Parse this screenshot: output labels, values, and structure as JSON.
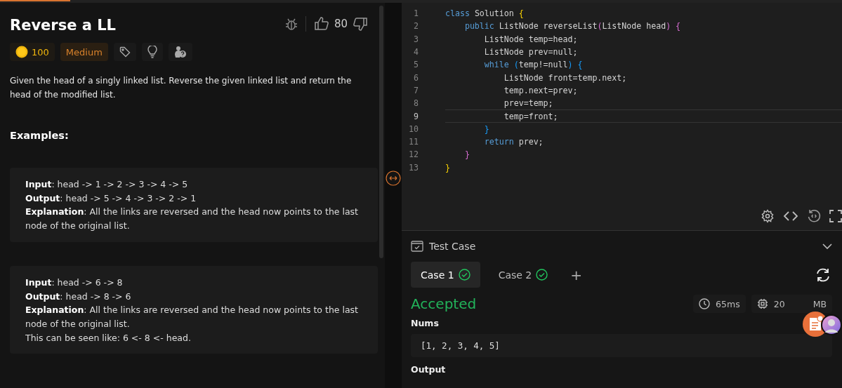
{
  "problem": {
    "title": "Reverse a LL",
    "likes": "80",
    "coins": "100",
    "difficulty": "Medium",
    "description": "Given the head of a singly linked list. Reverse the given linked list and return the head of the modified list.",
    "examples_heading": "Examples:",
    "examples": [
      {
        "lines": [
          "**Input**: head -> 1 -> 2 -> 3 -> 4 -> 5",
          "**Output**: head -> 5 -> 4 -> 3 -> 2 -> 1",
          "**Explanation**: All the links are reversed and the head now points to the last node of the original list."
        ]
      },
      {
        "lines": [
          "**Input**: head -> 6 -> 8",
          "**Output**: head -> 8 -> 6",
          "**Explanation**: All the links are reversed and the head now points to the last node of the original list.",
          "This can be seen like: 6 <- 8 <- head."
        ]
      }
    ]
  },
  "editor": {
    "lines": [
      {
        "number": "1",
        "current": false,
        "tokens": [
          {
            "kind": "keyword",
            "text": "class "
          },
          {
            "kind": "plain",
            "text": "Solution "
          },
          {
            "kind": "bracket1",
            "text": "{"
          }
        ],
        "children": [
          {
            "number": "2",
            "current": false,
            "tokens": [
              {
                "kind": "keyword",
                "text": "public "
              },
              {
                "kind": "plain",
                "text": "ListNode reverseList"
              },
              {
                "kind": "bracket2",
                "text": "("
              },
              {
                "kind": "plain",
                "text": "ListNode head"
              },
              {
                "kind": "bracket2",
                "text": ") "
              },
              {
                "kind": "bracket2",
                "text": "{"
              }
            ],
            "children": [
              {
                "number": "3",
                "current": false,
                "tokens": [
                  {
                    "kind": "plain",
                    "text": "ListNode temp=head;"
                  }
                ]
              },
              {
                "number": "4",
                "current": false,
                "tokens": [
                  {
                    "kind": "plain",
                    "text": "ListNode prev=null;"
                  }
                ]
              },
              {
                "number": "5",
                "current": false,
                "tokens": [
                  {
                    "kind": "keyword",
                    "text": "while "
                  },
                  {
                    "kind": "bracket3",
                    "text": "("
                  },
                  {
                    "kind": "plain",
                    "text": "temp!=null"
                  },
                  {
                    "kind": "bracket3",
                    "text": ") "
                  },
                  {
                    "kind": "bracket3",
                    "text": "{"
                  }
                ],
                "children": [
                  {
                    "number": "6",
                    "current": false,
                    "tokens": [
                      {
                        "kind": "plain",
                        "text": "ListNode front=temp.next;"
                      }
                    ]
                  },
                  {
                    "number": "7",
                    "current": false,
                    "tokens": [
                      {
                        "kind": "plain",
                        "text": "temp.next=prev;"
                      }
                    ]
                  },
                  {
                    "number": "8",
                    "current": false,
                    "tokens": [
                      {
                        "kind": "plain",
                        "text": "prev=temp;"
                      }
                    ]
                  },
                  {
                    "number": "9",
                    "current": true,
                    "tokens": [
                      {
                        "kind": "plain",
                        "text": "temp=front;"
                      }
                    ]
                  }
                ]
              },
              {
                "number": "10",
                "current": false,
                "tokens": [
                  {
                    "kind": "bracket3",
                    "text": "}"
                  }
                ]
              },
              {
                "number": "11",
                "current": false,
                "tokens": [
                  {
                    "kind": "keyword",
                    "text": "return "
                  },
                  {
                    "kind": "plain",
                    "text": "prev;"
                  }
                ]
              }
            ]
          },
          {
            "number": "12",
            "current": false,
            "tokens": [
              {
                "kind": "bracket2",
                "text": "}"
              }
            ]
          }
        ]
      },
      {
        "number": "13",
        "current": false,
        "tokens": [
          {
            "kind": "bracket1",
            "text": "}"
          }
        ]
      }
    ]
  },
  "testcase": {
    "title": "Test Case",
    "cases": [
      {
        "label": "Case 1",
        "selected": true,
        "passed": true
      },
      {
        "label": "Case 2",
        "selected": false,
        "passed": true
      }
    ],
    "add": "+",
    "verdict": "Accepted",
    "runtime": "65ms",
    "memory_start": "20",
    "memory_end": "MB",
    "input_label": "Nums",
    "input_value": "[1, 2, 3, 4, 5]",
    "output_label": "Output"
  }
}
